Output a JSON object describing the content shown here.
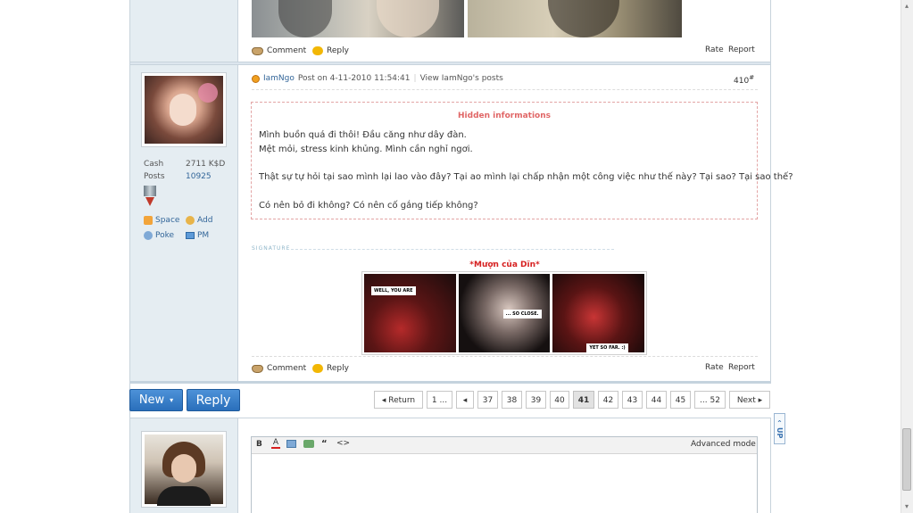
{
  "post_top": {
    "comment_label": "Comment",
    "reply_label": "Reply",
    "rate_label": "Rate",
    "report_label": "Report"
  },
  "post": {
    "author": "IamNgo",
    "post_on": "Post on 4-11-2010 11:54:41",
    "view_posts": "View IamNgo's posts",
    "floor": "410",
    "floor_suffix": "#",
    "hidden_title": "Hidden informations",
    "lines": [
      "Mình buồn quá đi thôi! Đầu căng như dây đàn.",
      "Mệt mỏi, stress kinh khủng. Mình cần nghỉ ngơi.",
      "Thật sự tự hỏi tại sao mình lại lao vào đây? Tại ao mình lại chấp nhận một công việc như thế này? Tại sao? Tại sao thế?",
      "Có nên bỏ đi không? Có nên cố gắng tiếp không?"
    ],
    "signature_label": "SIGNATURE",
    "signature_caption": "*Mượn của Dĩn*",
    "comic_texts": [
      "WELL, YOU ARE",
      "... SO CLOSE.",
      "YET SO FAR. :)"
    ],
    "comment_label": "Comment",
    "reply_label": "Reply",
    "rate_label": "Rate",
    "report_label": "Report"
  },
  "profile": {
    "cash_label": "Cash",
    "cash_value": "2711 K$D",
    "posts_label": "Posts",
    "posts_value": "10925",
    "space": "Space",
    "add": "Add",
    "poke": "Poke",
    "pm": "PM"
  },
  "actions": {
    "new_label": "New",
    "new_arrow": "▾",
    "reply_label": "Reply"
  },
  "pagination": {
    "return_label": "Return",
    "first": "1 ...",
    "pages": [
      "37",
      "38",
      "39",
      "40",
      "41",
      "42",
      "43",
      "44",
      "45"
    ],
    "current": "41",
    "last": "... 52",
    "next_label": "Next",
    "up_label": "UP"
  },
  "editor": {
    "bold": "B",
    "advanced_mode": "Advanced mode"
  },
  "colors": {
    "accent": "#2a6fbb",
    "hidden_title": "#e06666",
    "signature_caption": "#d62020",
    "link": "#336699"
  }
}
